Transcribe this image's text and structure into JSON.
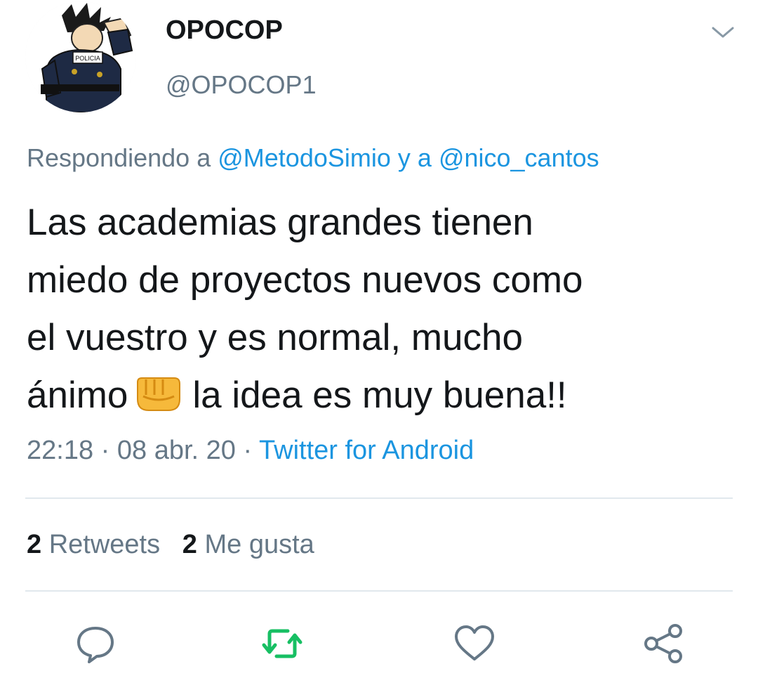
{
  "author": {
    "display_name": "OPOCOP",
    "handle": "@OPOCOP1",
    "avatar_badge_text": "POLICIA"
  },
  "reply": {
    "prefix": "Respondiendo a",
    "mention1": "@MetodoSimio",
    "connector": "y a",
    "mention2": "@nico_cantos"
  },
  "tweet": {
    "line1": "Las academias grandes tienen",
    "line2": "miedo de proyectos nuevos como",
    "line3": "el vuestro y es normal, mucho",
    "line4_before": "ánimo",
    "line4_after": "la idea es muy buena!!",
    "emoji_icon": "raised-fist-icon"
  },
  "meta": {
    "time": "22:18",
    "date": "08 abr. 20",
    "separator": "·",
    "source": "Twitter for Android"
  },
  "stats": {
    "retweets_count": "2",
    "retweets_label": "Retweets",
    "likes_count": "2",
    "likes_label": "Me gusta"
  },
  "actions": {
    "reply_icon": "reply-icon",
    "retweet_icon": "retweet-icon",
    "like_icon": "heart-icon",
    "share_icon": "share-icon"
  },
  "colors": {
    "link_blue": "#1b95e0",
    "retweet_green": "#17bf63",
    "icon_gray": "#657786",
    "text_dark": "#14171a"
  }
}
